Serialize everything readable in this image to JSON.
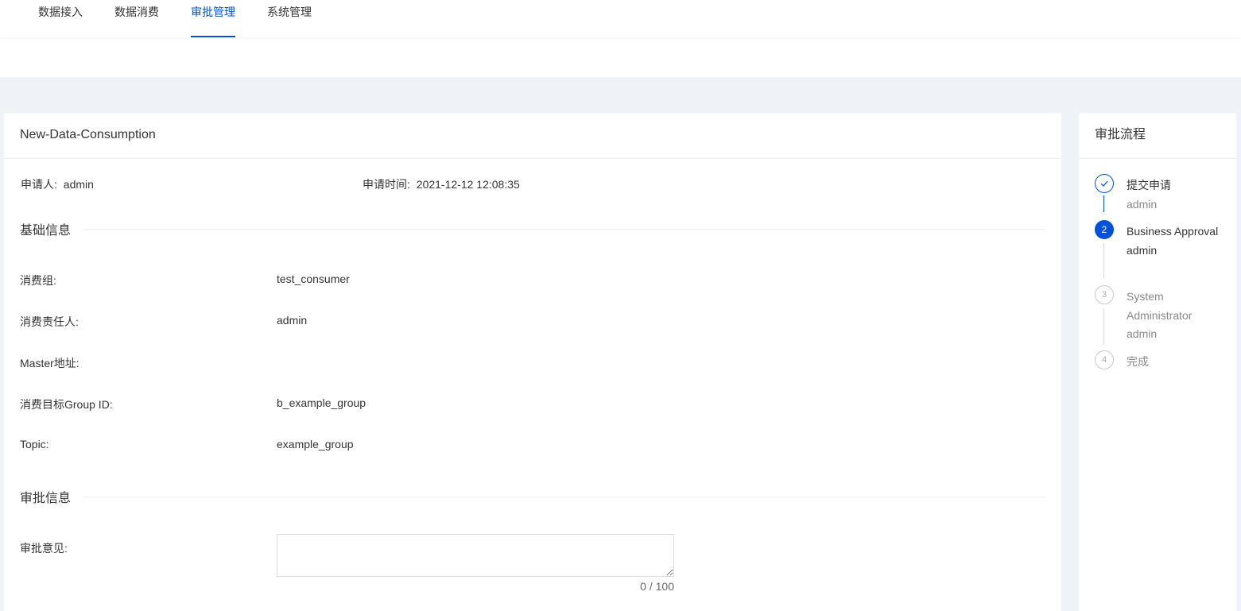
{
  "nav": {
    "tabs": [
      {
        "label": "数据接入"
      },
      {
        "label": "数据消费"
      },
      {
        "label": "审批管理"
      },
      {
        "label": "系统管理"
      }
    ]
  },
  "main": {
    "title": "New-Data-Consumption",
    "applicant_label": "申请人:",
    "applicant": "admin",
    "time_label": "申请时间:",
    "time": "2021-12-12 12:08:35",
    "basic_section": "基础信息",
    "fields": [
      {
        "label": "消费组:",
        "value": "test_consumer"
      },
      {
        "label": "消费责任人:",
        "value": "admin"
      },
      {
        "label": "Master地址:",
        "value": ""
      },
      {
        "label": "消费目标Group ID:",
        "value": "b_example_group"
      },
      {
        "label": "Topic:",
        "value": "example_group"
      }
    ],
    "approval_section": "审批信息",
    "opinion_label": "审批意见:",
    "opinion_value": "",
    "counter": "0 / 100"
  },
  "side": {
    "title": "审批流程",
    "steps": [
      {
        "icon": "check-icon",
        "name": "提交申请",
        "sub": "admin",
        "status": "done"
      },
      {
        "icon": "2",
        "name": "Business Approval",
        "sub": "admin",
        "status": "current"
      },
      {
        "icon": "3",
        "name": "System Administrator",
        "sub": "admin",
        "status": "pending"
      },
      {
        "icon": "4",
        "name": "完成",
        "sub": "",
        "status": "pending"
      }
    ]
  },
  "colors": {
    "accent": "#0052d9",
    "background": "#eff2f6"
  }
}
